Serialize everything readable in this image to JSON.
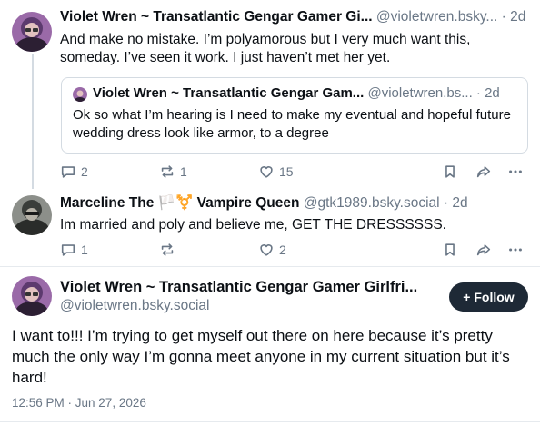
{
  "posts": [
    {
      "name": "Violet Wren ~ Transatlantic Gengar Gamer Gi...",
      "handle": "@violetwren.bsky...",
      "time": "2d",
      "text": "And make no mistake. I’m polyamorous but I very much want this, someday. I’ve seen it work. I just haven’t met her yet.",
      "quote": {
        "name": "Violet Wren ~ Transatlantic Gengar Gam...",
        "handle": "@violetwren.bs...",
        "time": "2d",
        "text": "Ok so what I’m hearing is I need to make my eventual and hopeful future wedding dress look like armor, to a degree"
      },
      "replies": "2",
      "reposts": "1",
      "likes": "15"
    },
    {
      "name": "Marceline The 🏳️⚧️ Vampire Queen",
      "handle": "@gtk1989.bsky.social",
      "time": "2d",
      "text": "Im married and poly and believe me, GET THE DRESSSSSS.",
      "replies": "1",
      "reposts": "",
      "likes": "2"
    }
  ],
  "main_post": {
    "name": "Violet Wren ~ Transatlantic Gengar Gamer Girlfri...",
    "handle": "@violetwren.bsky.social",
    "follow_label": "+ Follow",
    "text": "I want to!!! I’m trying to get myself out there on here because it’s pretty much the only way I’m gonna meet anyone in my current situation but it’s hard!",
    "timestamp": "12:56 PM · Jun 27, 2026"
  },
  "separator": "·",
  "colors": {
    "accent": "#1e2936",
    "muted": "#6a7786",
    "border": "#d4dbe2"
  },
  "icons": [
    "reply-icon",
    "repost-icon",
    "like-icon",
    "bookmark-icon",
    "share-icon",
    "more-icon"
  ]
}
